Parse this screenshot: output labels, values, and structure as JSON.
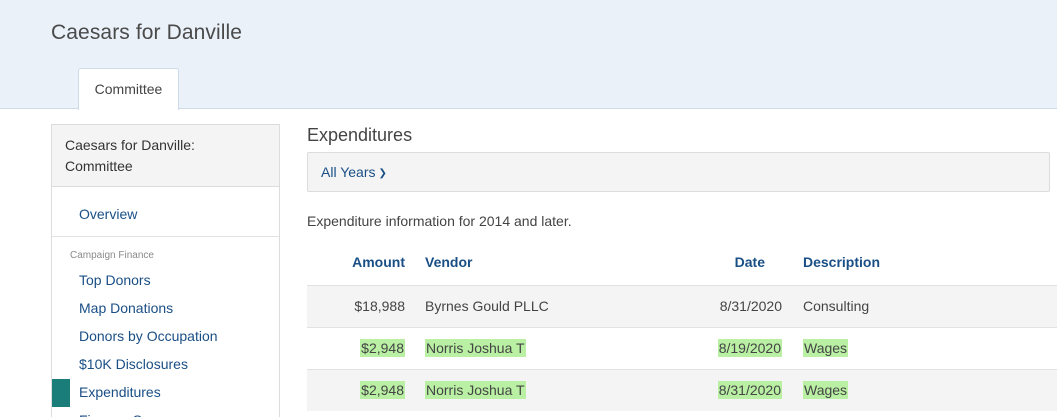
{
  "header": {
    "title": "Caesars for Danville",
    "tabs": [
      {
        "label": "Committee"
      }
    ]
  },
  "sidebar": {
    "heading": "Caesars for Danville: Committee",
    "overview": "Overview",
    "section_label": "Campaign Finance",
    "items": [
      {
        "label": "Top Donors"
      },
      {
        "label": "Map Donations"
      },
      {
        "label": "Donors by Occupation"
      },
      {
        "label": "$10K Disclosures"
      },
      {
        "label": "Expenditures"
      },
      {
        "label": "Finance Summary"
      }
    ],
    "active_item": "Expenditures"
  },
  "main": {
    "title": "Expenditures",
    "filter": {
      "label": "All Years"
    },
    "info": "Expenditure information for 2014 and later.",
    "table": {
      "columns": [
        "Amount",
        "Vendor",
        "Date",
        "Description"
      ],
      "rows": [
        {
          "amount": "$18,988",
          "vendor": "Byrnes Gould PLLC",
          "date": "8/31/2020",
          "description": "Consulting"
        },
        {
          "amount": "$2,948",
          "vendor": "Norris Joshua T",
          "date": "8/19/2020",
          "description": "Wages"
        },
        {
          "amount": "$2,948",
          "vendor": "Norris Joshua T",
          "date": "8/31/2020",
          "description": "Wages"
        }
      ]
    }
  },
  "colors": {
    "header_bg": "#eaf1f9",
    "link": "#1a4f86",
    "active_marker": "#1a7d7a",
    "highlight": "#b9f0a4"
  }
}
